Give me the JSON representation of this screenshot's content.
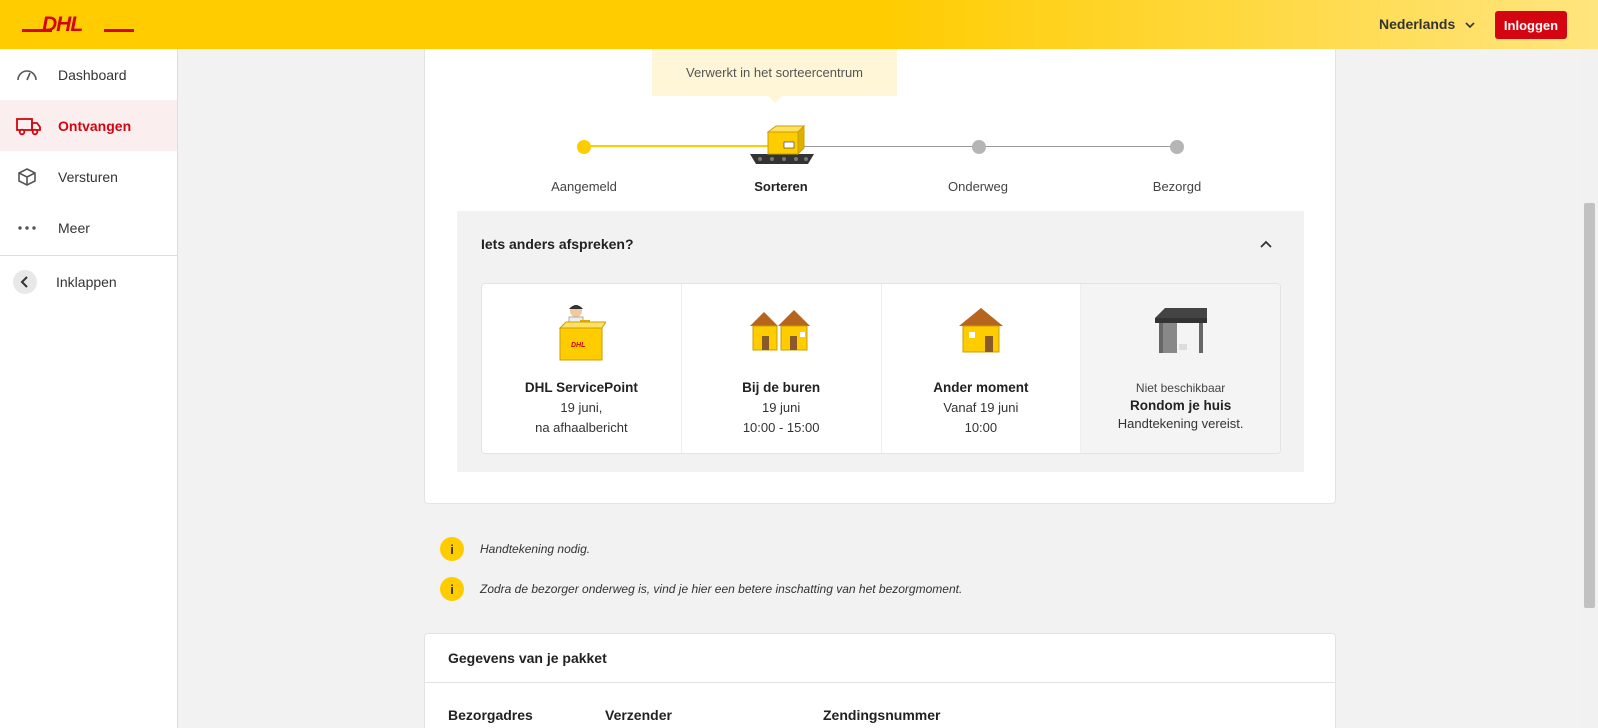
{
  "header": {
    "language": "Nederlands",
    "login_label": "Inloggen"
  },
  "sidebar": {
    "items": [
      {
        "label": "Dashboard",
        "icon": "gauge-icon"
      },
      {
        "label": "Ontvangen",
        "icon": "truck-icon",
        "active": true
      },
      {
        "label": "Versturen",
        "icon": "package-icon"
      },
      {
        "label": "Meer",
        "icon": "more-dots-icon"
      }
    ],
    "collapse_label": "Inklappen"
  },
  "tracking": {
    "tooltip": "Verwerkt in het sorteercentrum",
    "steps": [
      "Aangemeld",
      "Sorteren",
      "Onderweg",
      "Bezorgd"
    ],
    "current_step": 1
  },
  "options_panel": {
    "title": "Iets anders afspreken?",
    "options": [
      {
        "title": "DHL ServicePoint",
        "line1": "19 juni,",
        "line2": "na afhaalbericht"
      },
      {
        "title": "Bij de buren",
        "line1": "19 juni",
        "line2": "10:00 - 15:00"
      },
      {
        "title": "Ander moment",
        "line1": "Vanaf 19 juni",
        "line2": "10:00"
      },
      {
        "status": "Niet beschikbaar",
        "title": "Rondom je huis",
        "line1": "Handtekening vereist."
      }
    ]
  },
  "notices": [
    "Handtekening nodig.",
    "Zodra de bezorger onderweg is, vind je hier een betere inschatting van het bezorgmoment."
  ],
  "package_details": {
    "title": "Gegevens van je pakket",
    "columns": [
      "Bezorgadres",
      "Verzender",
      "Zendingsnummer"
    ]
  },
  "colors": {
    "brand_yellow": "#ffcc00",
    "brand_red": "#d40511"
  }
}
